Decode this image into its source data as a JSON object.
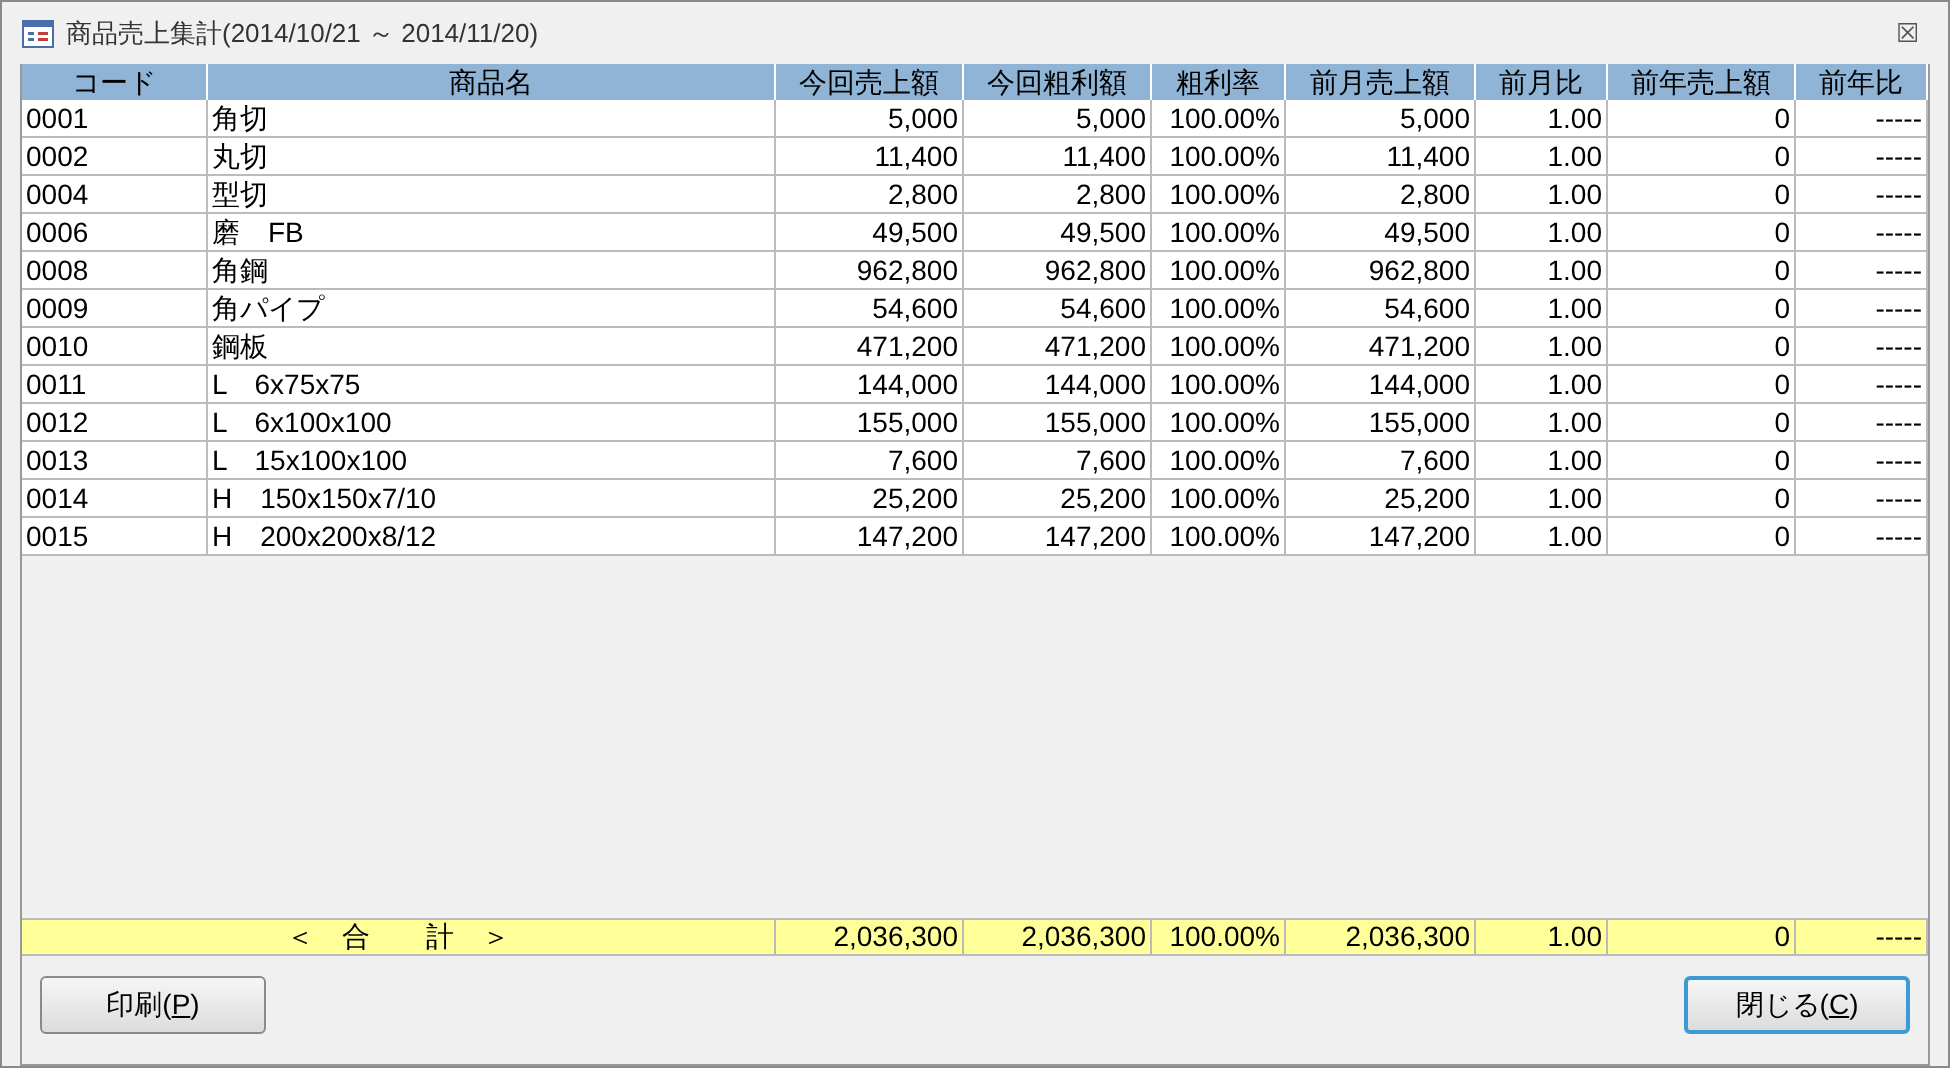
{
  "window": {
    "title": "商品売上集計(2014/10/21 ～ 2014/11/20)",
    "close": "☒"
  },
  "table": {
    "columns": [
      "コード",
      "商品名",
      "今回売上額",
      "今回粗利額",
      "粗利率",
      "前月売上額",
      "前月比",
      "前年売上額",
      "前年比"
    ],
    "rows": [
      [
        "0001",
        "角切",
        "5,000",
        "5,000",
        "100.00%",
        "5,000",
        "1.00",
        "0",
        "-----"
      ],
      [
        "0002",
        "丸切",
        "11,400",
        "11,400",
        "100.00%",
        "11,400",
        "1.00",
        "0",
        "-----"
      ],
      [
        "0004",
        "型切",
        "2,800",
        "2,800",
        "100.00%",
        "2,800",
        "1.00",
        "0",
        "-----"
      ],
      [
        "0006",
        "磨　FB",
        "49,500",
        "49,500",
        "100.00%",
        "49,500",
        "1.00",
        "0",
        "-----"
      ],
      [
        "0008",
        "角鋼",
        "962,800",
        "962,800",
        "100.00%",
        "962,800",
        "1.00",
        "0",
        "-----"
      ],
      [
        "0009",
        "角パイプ",
        "54,600",
        "54,600",
        "100.00%",
        "54,600",
        "1.00",
        "0",
        "-----"
      ],
      [
        "0010",
        "鋼板",
        "471,200",
        "471,200",
        "100.00%",
        "471,200",
        "1.00",
        "0",
        "-----"
      ],
      [
        "0011",
        "L　6x75x75",
        "144,000",
        "144,000",
        "100.00%",
        "144,000",
        "1.00",
        "0",
        "-----"
      ],
      [
        "0012",
        "L　6x100x100",
        "155,000",
        "155,000",
        "100.00%",
        "155,000",
        "1.00",
        "0",
        "-----"
      ],
      [
        "0013",
        "L　15x100x100",
        "7,600",
        "7,600",
        "100.00%",
        "7,600",
        "1.00",
        "0",
        "-----"
      ],
      [
        "0014",
        "H　150x150x7/10",
        "25,200",
        "25,200",
        "100.00%",
        "25,200",
        "1.00",
        "0",
        "-----"
      ],
      [
        "0015",
        "H　200x200x8/12",
        "147,200",
        "147,200",
        "100.00%",
        "147,200",
        "1.00",
        "0",
        "-----"
      ]
    ],
    "total": [
      "＜　合　　計　＞",
      "2,036,300",
      "2,036,300",
      "100.00%",
      "2,036,300",
      "1.00",
      "0",
      "-----"
    ]
  },
  "buttons": [
    {
      "label": "印刷(",
      "mnemonic": "P",
      "suffix": ")",
      "focused": false
    },
    {
      "label": "閉じる(",
      "mnemonic": "C",
      "suffix": ")",
      "focused": true
    }
  ]
}
